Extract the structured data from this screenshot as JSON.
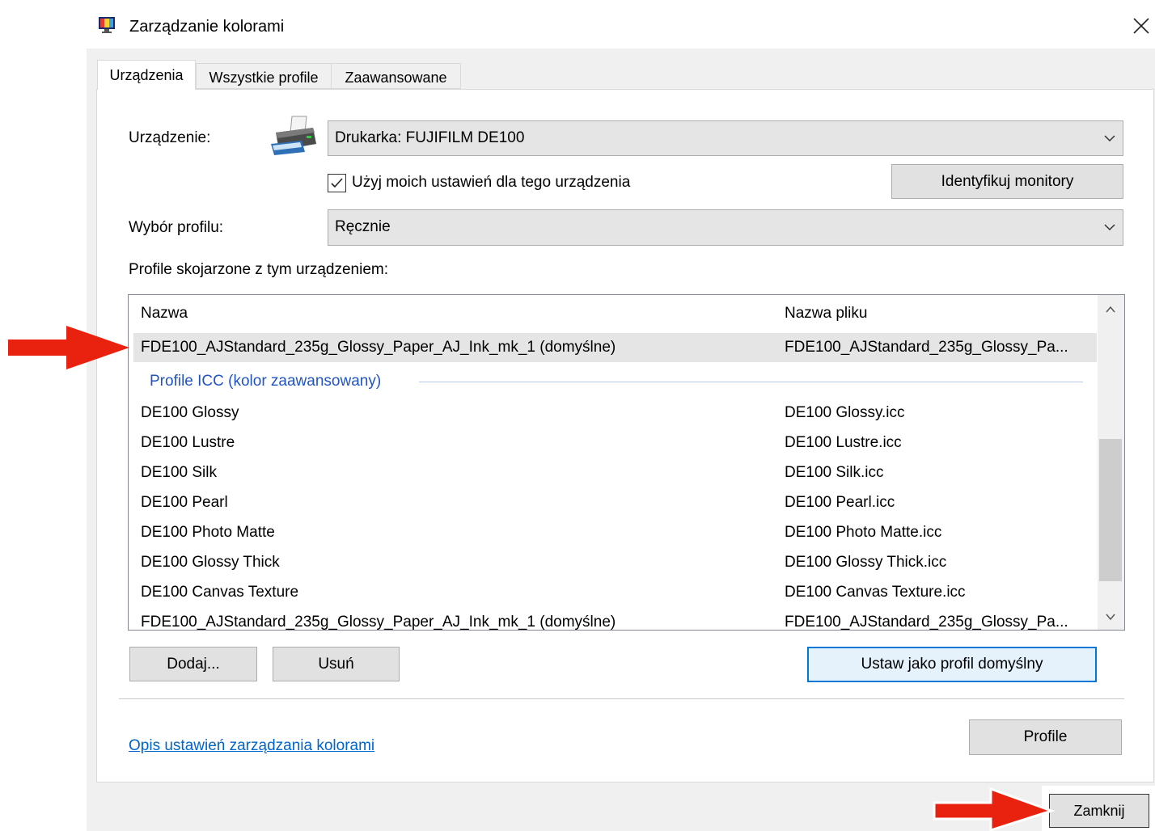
{
  "window": {
    "title": "Zarządzanie kolorami",
    "app_icon": "color-management-icon",
    "close_icon": "close-icon"
  },
  "tabs": [
    {
      "label": "Urządzenia",
      "selected": true
    },
    {
      "label": "Wszystkie profile",
      "selected": false
    },
    {
      "label": "Zaawansowane",
      "selected": false
    }
  ],
  "device": {
    "label": "Urządzenie:",
    "icon": "printer-icon",
    "value": "Drukarka: FUJIFILM DE100"
  },
  "use_my_settings": {
    "label": "Użyj moich ustawień dla tego urządzenia",
    "checked": true
  },
  "identify_button": "Identyfikuj monitory",
  "profile_selection": {
    "label": "Wybór profilu:",
    "value": "Ręcznie"
  },
  "profiles_label": "Profile skojarzone z tym urządzeniem:",
  "list": {
    "columns": [
      "Nazwa",
      "Nazwa pliku"
    ],
    "selected_row": {
      "name": "FDE100_AJStandard_235g_Glossy_Paper_AJ_Ink_mk_1 (domyślne)",
      "file": "FDE100_AJStandard_235g_Glossy_Pa..."
    },
    "group": "Profile ICC (kolor zaawansowany)",
    "rows": [
      {
        "name": "DE100 Glossy",
        "file": "DE100 Glossy.icc"
      },
      {
        "name": "DE100 Lustre",
        "file": "DE100 Lustre.icc"
      },
      {
        "name": "DE100 Silk",
        "file": "DE100 Silk.icc"
      },
      {
        "name": "DE100 Pearl",
        "file": "DE100 Pearl.icc"
      },
      {
        "name": "DE100 Photo Matte",
        "file": "DE100 Photo Matte.icc"
      },
      {
        "name": "DE100 Glossy Thick",
        "file": "DE100 Glossy Thick.icc"
      },
      {
        "name": "DE100 Canvas Texture",
        "file": "DE100 Canvas Texture.icc"
      },
      {
        "name": "FDE100_AJStandard_235g_Glossy_Paper_AJ_Ink_mk_1 (domyślne)",
        "file": "FDE100_AJStandard_235g_Glossy_Pa..."
      }
    ]
  },
  "buttons": {
    "add": "Dodaj...",
    "remove": "Usuń",
    "set_default": "Ustaw jako profil domyślny",
    "profiles": "Profile",
    "close": "Zamknij"
  },
  "link": "Opis ustawień zarządzania kolorami",
  "colors": {
    "accent": "#0078d7",
    "link": "#0066cc",
    "group_header": "#2154c2",
    "annotation_arrow": "#e8220f",
    "dialog_bg": "#f0f0f0"
  }
}
